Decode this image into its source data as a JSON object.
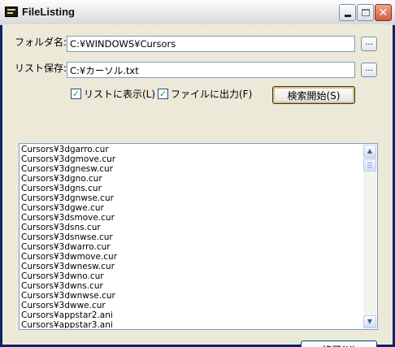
{
  "window": {
    "title": "FileListing",
    "controls": {
      "minimize_icon": "minimize-icon",
      "maximize_icon": "maximize-icon",
      "close_icon": "close-icon"
    }
  },
  "form": {
    "folder_label": "フォルダ名:",
    "folder_value": "C:¥WINDOWS¥Cursors",
    "list_save_label": "リスト保存:",
    "list_save_value": "C:¥カーソル.txt",
    "browse_label": "...",
    "show_in_list_label": "リストに表示(L)",
    "output_to_file_label": "ファイルに出力(F)",
    "show_in_list_checked": true,
    "output_to_file_checked": true,
    "search_start_label": "検索開始(S)",
    "exit_label": "終了(X)"
  },
  "list": {
    "items": [
      "Cursors¥3dgarro.cur",
      "Cursors¥3dgmove.cur",
      "Cursors¥3dgnesw.cur",
      "Cursors¥3dgno.cur",
      "Cursors¥3dgns.cur",
      "Cursors¥3dgnwse.cur",
      "Cursors¥3dgwe.cur",
      "Cursors¥3dsmove.cur",
      "Cursors¥3dsns.cur",
      "Cursors¥3dsnwse.cur",
      "Cursors¥3dwarro.cur",
      "Cursors¥3dwmove.cur",
      "Cursors¥3dwnesw.cur",
      "Cursors¥3dwno.cur",
      "Cursors¥3dwns.cur",
      "Cursors¥3dwnwse.cur",
      "Cursors¥3dwwe.cur",
      "Cursors¥appstar2.ani",
      "Cursors¥appstar3.ani"
    ]
  },
  "colors": {
    "titlebar": "#e6e6e6",
    "client": "#ece9d8",
    "field_border": "#7f9db9",
    "checkmark": "#21a121"
  }
}
